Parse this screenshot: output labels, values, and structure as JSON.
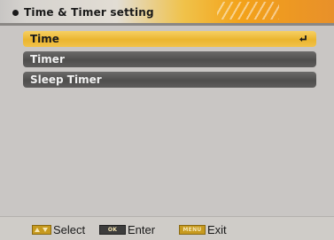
{
  "header": {
    "title": "Time & Timer setting",
    "bullet_icon": "circle-bullet-icon"
  },
  "menu": {
    "items": [
      {
        "label": "Time",
        "selected": true,
        "icon": "enter-return-icon"
      },
      {
        "label": "Timer",
        "selected": false
      },
      {
        "label": "Sleep Timer",
        "selected": false
      }
    ]
  },
  "footer": {
    "hints": [
      {
        "key_icon": "arrow-keys-icon",
        "label": "Select"
      },
      {
        "key_text": "OK",
        "label": "Enter"
      },
      {
        "key_text": "MENU",
        "label": "Exit"
      }
    ]
  },
  "colors": {
    "accent": "#EBB52F",
    "item_bg": "#4F4E4D",
    "panel_bg": "#C9C6C4"
  }
}
